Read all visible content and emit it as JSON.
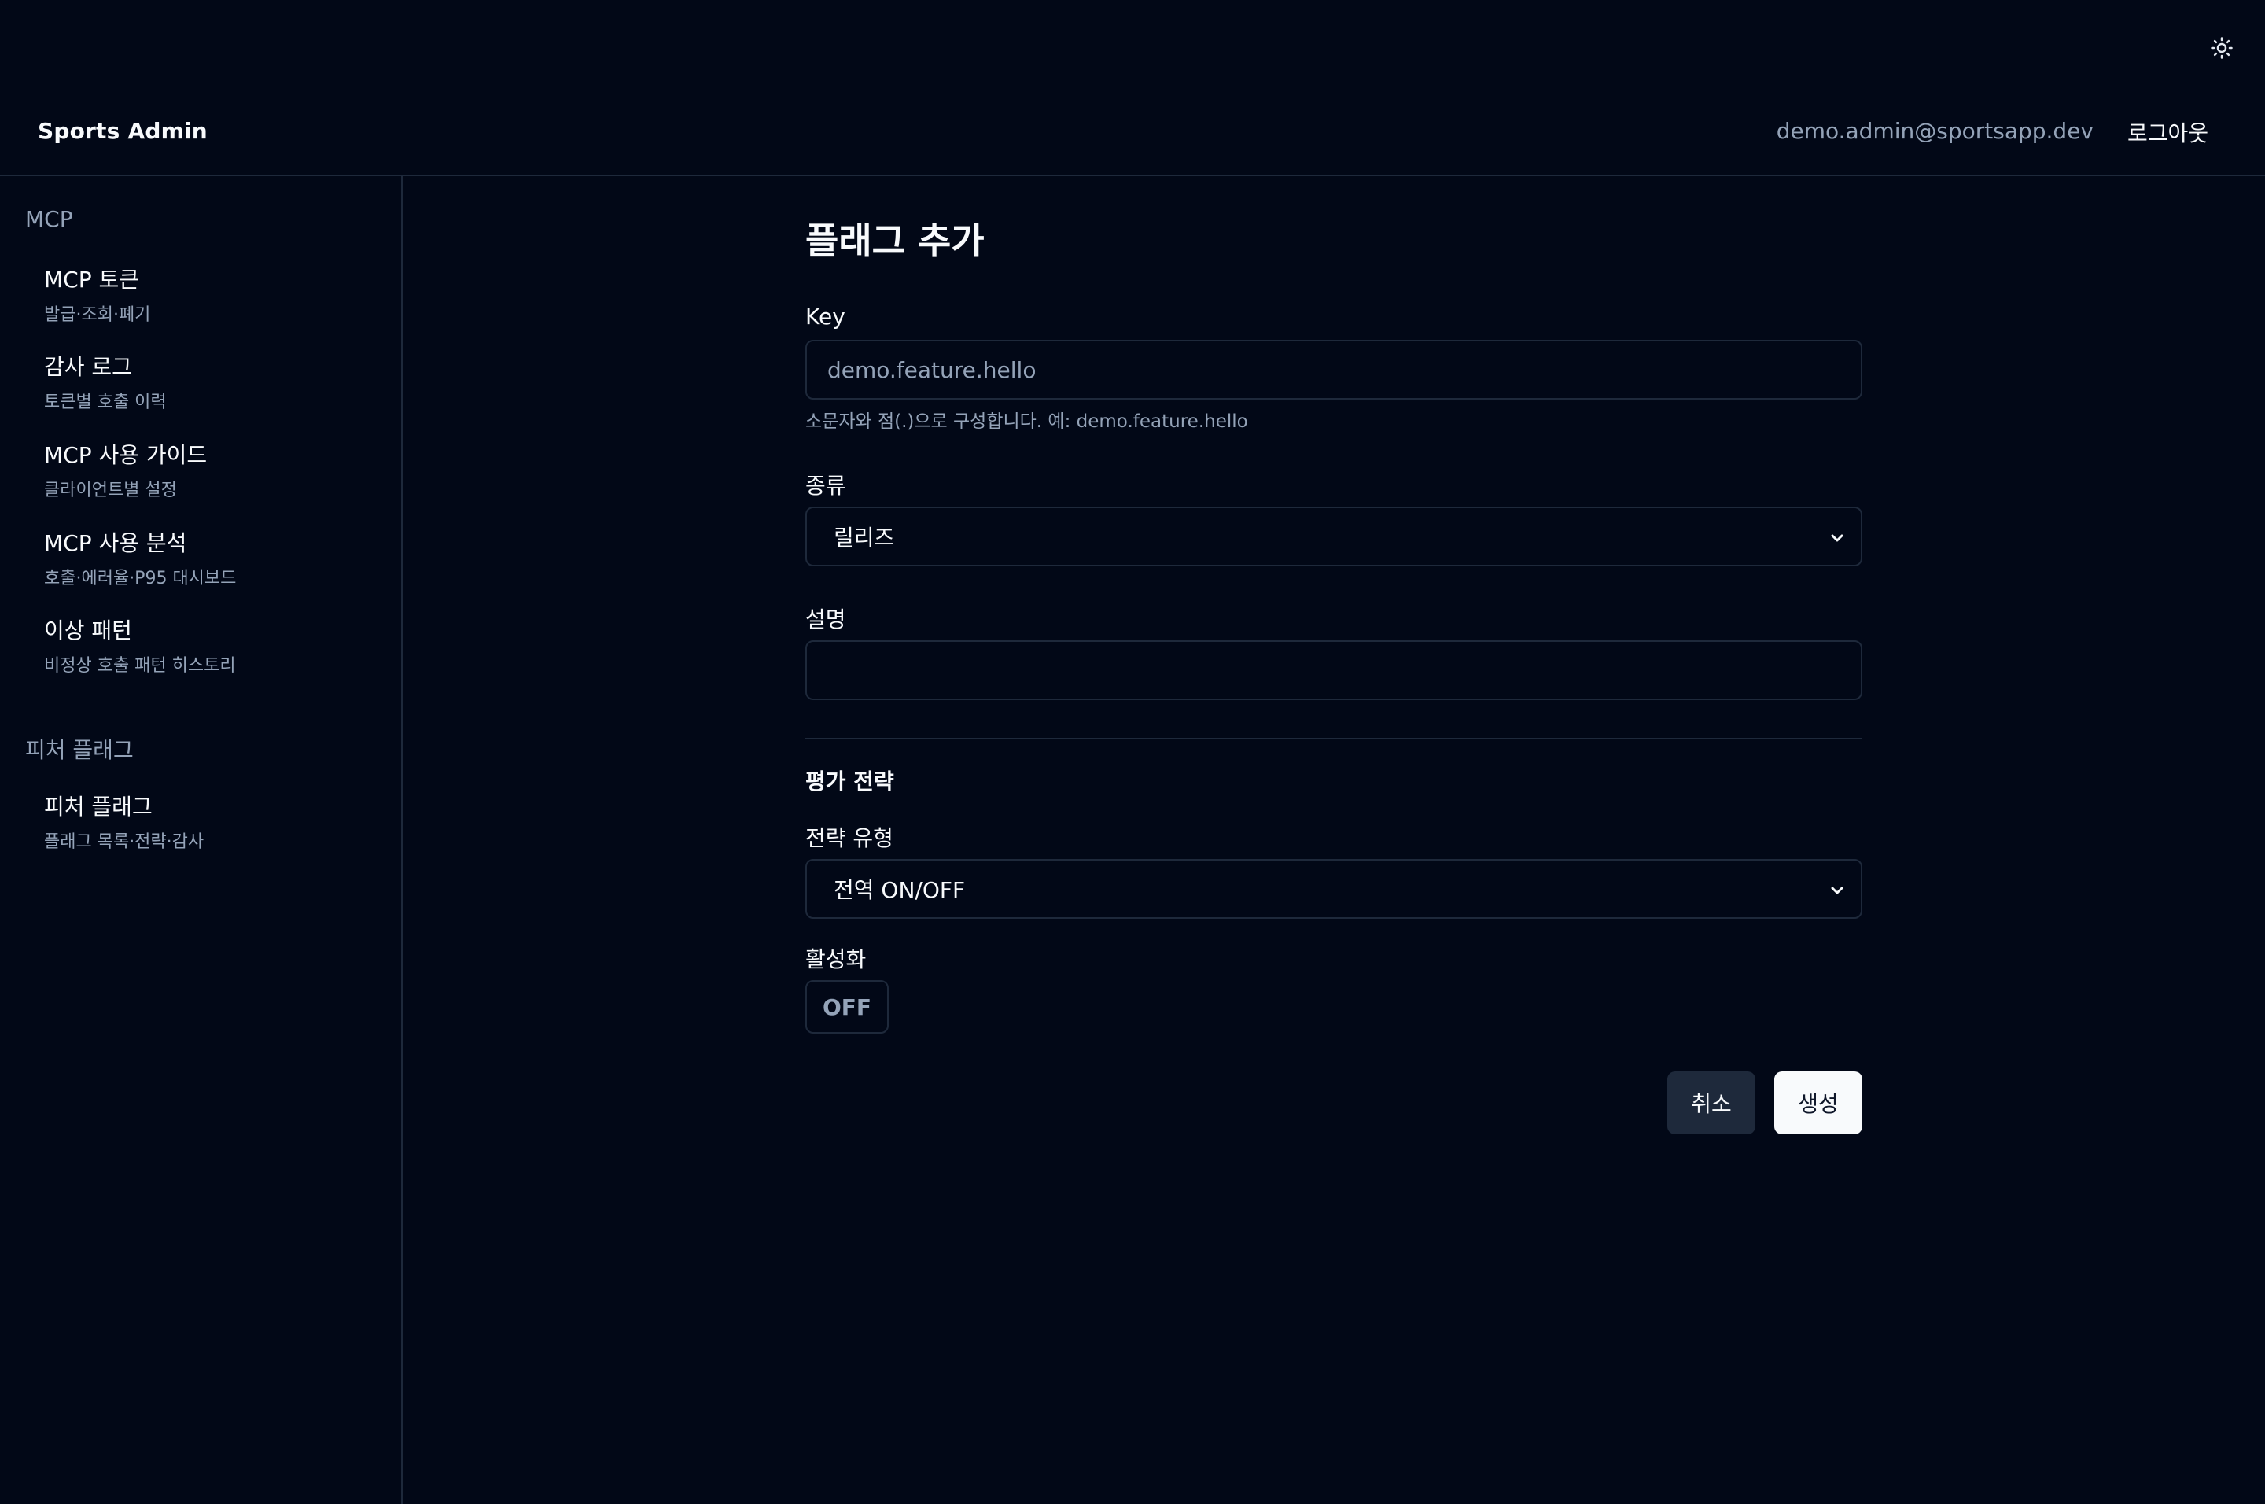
{
  "header": {
    "brand": "Sports Admin",
    "user_email": "demo.admin@sportsapp.dev",
    "logout_label": "로그아웃",
    "theme_icon": "sun-icon"
  },
  "sidebar": {
    "sections": [
      {
        "title": "MCP",
        "items": [
          {
            "title": "MCP 토큰",
            "subtitle": "발급·조회·폐기"
          },
          {
            "title": "감사 로그",
            "subtitle": "토큰별 호출 이력"
          },
          {
            "title": "MCP 사용 가이드",
            "subtitle": "클라이언트별 설정"
          },
          {
            "title": "MCP 사용 분석",
            "subtitle": "호출·에러율·P95 대시보드"
          },
          {
            "title": "이상 패턴",
            "subtitle": "비정상 호출 패턴 히스토리"
          }
        ]
      },
      {
        "title": "피처 플래그",
        "items": [
          {
            "title": "피처 플래그",
            "subtitle": "플래그 목록·전략·감사"
          }
        ]
      }
    ]
  },
  "form": {
    "title": "플래그 추가",
    "key": {
      "label": "Key",
      "placeholder": "demo.feature.hello",
      "value": "",
      "help": "소문자와 점(.)으로 구성합니다. 예: demo.feature.hello"
    },
    "kind": {
      "label": "종류",
      "selected": "릴리즈"
    },
    "description": {
      "label": "설명",
      "value": ""
    },
    "strategy_section": "평가 전략",
    "strategy_type": {
      "label": "전략 유형",
      "selected": "전역 ON/OFF"
    },
    "enabled": {
      "label": "활성화",
      "value": "OFF"
    },
    "cancel_label": "취소",
    "create_label": "생성"
  },
  "colors": {
    "background": "#020817",
    "border": "#1e293b",
    "muted_text": "#94a3b8",
    "primary_button": "#f8fafc",
    "secondary_button": "#1e293b"
  }
}
